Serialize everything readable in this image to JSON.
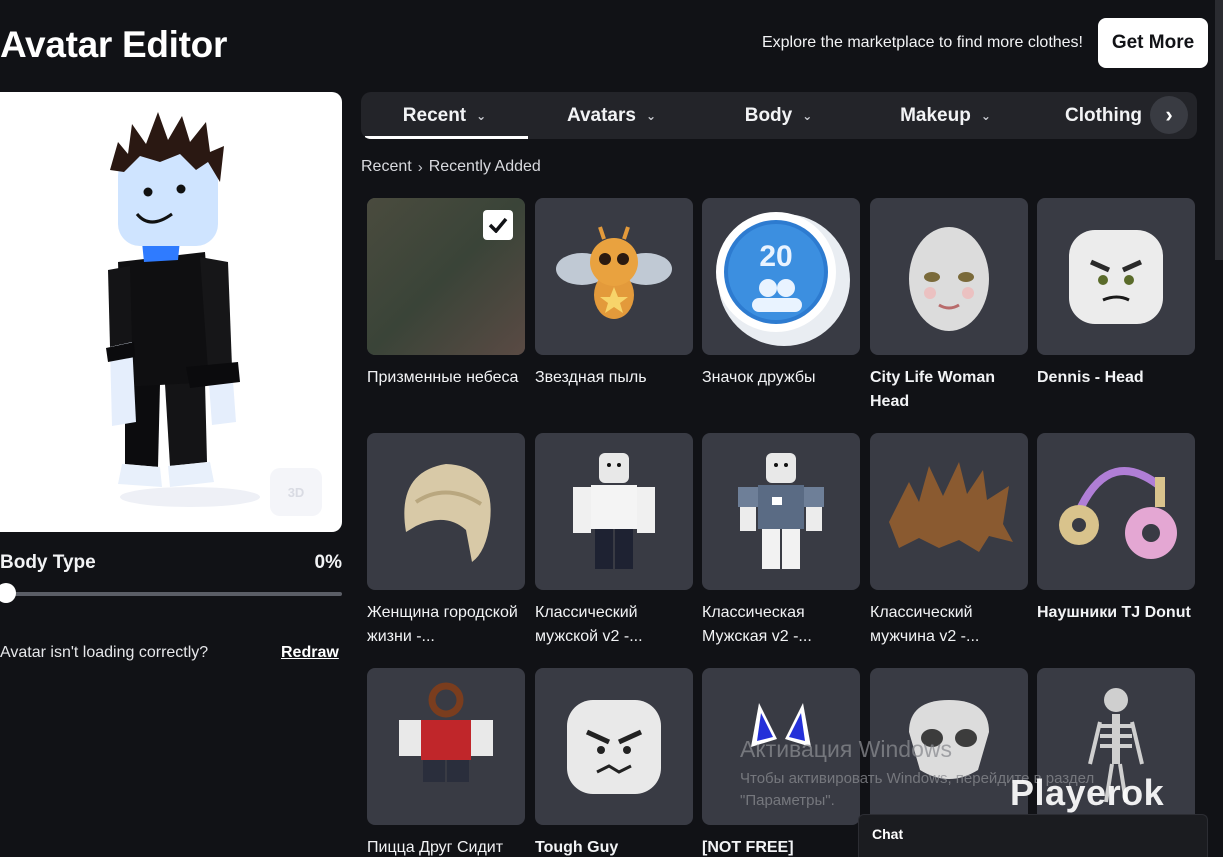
{
  "header": {
    "title": "Avatar Editor",
    "promo": "Explore the marketplace to find more clothes!",
    "get_more": "Get More"
  },
  "preview": {
    "view_toggle": "3D",
    "body_type_label": "Body Type",
    "body_type_value": "0%",
    "body_type_percent": 0,
    "loading_question": "Avatar isn't loading correctly?",
    "redraw": "Redraw"
  },
  "tabs": [
    {
      "label": "Recent",
      "active": true
    },
    {
      "label": "Avatars",
      "active": false
    },
    {
      "label": "Body",
      "active": false
    },
    {
      "label": "Makeup",
      "active": false
    },
    {
      "label": "Clothing",
      "active": false
    }
  ],
  "breadcrumb": {
    "root": "Recent",
    "current": "Recently Added"
  },
  "items": [
    {
      "name": "Призменные небеса",
      "bold": false,
      "equipped": true,
      "icon": "gradient-sky"
    },
    {
      "name": "Звездная пыль",
      "bold": false,
      "equipped": false,
      "icon": "bee-pet"
    },
    {
      "name": "Значок дружбы",
      "bold": false,
      "equipped": false,
      "icon": "friend-badge"
    },
    {
      "name": "City Life Woman Head",
      "bold": true,
      "equipped": false,
      "icon": "woman-head"
    },
    {
      "name": "Dennis - Head",
      "bold": true,
      "equipped": false,
      "icon": "block-head"
    },
    {
      "name": "Женщина городской жизни -...",
      "bold": false,
      "equipped": false,
      "icon": "blonde-hair"
    },
    {
      "name": "Классический мужской v2 -...",
      "bold": false,
      "equipped": false,
      "icon": "classic-male"
    },
    {
      "name": "Классическая Мужская v2 -...",
      "bold": false,
      "equipped": false,
      "icon": "classic-shirt"
    },
    {
      "name": "Классический мужчина v2 -...",
      "bold": false,
      "equipped": false,
      "icon": "spiky-hair"
    },
    {
      "name": "Наушники TJ Donut",
      "bold": true,
      "equipped": false,
      "icon": "donut-headphones"
    },
    {
      "name": "Пицца Друг Сидит",
      "bold": false,
      "equipped": false,
      "icon": "pretzel-avatar"
    },
    {
      "name": "Tough Guy",
      "bold": true,
      "equipped": false,
      "icon": "tough-face"
    },
    {
      "name": "[NOT FREE]",
      "bold": true,
      "equipped": false,
      "icon": "blue-ears"
    },
    {
      "name": "",
      "bold": false,
      "equipped": false,
      "icon": "skull-mask"
    },
    {
      "name": "",
      "bold": false,
      "equipped": false,
      "icon": "skeleton"
    }
  ],
  "overlay": {
    "activation_title": "Активация Windows",
    "activation_text": "Чтобы активировать Windows, перейдите в раздел \"Параметры\".",
    "brand": "Playerok",
    "chat": "Chat"
  }
}
